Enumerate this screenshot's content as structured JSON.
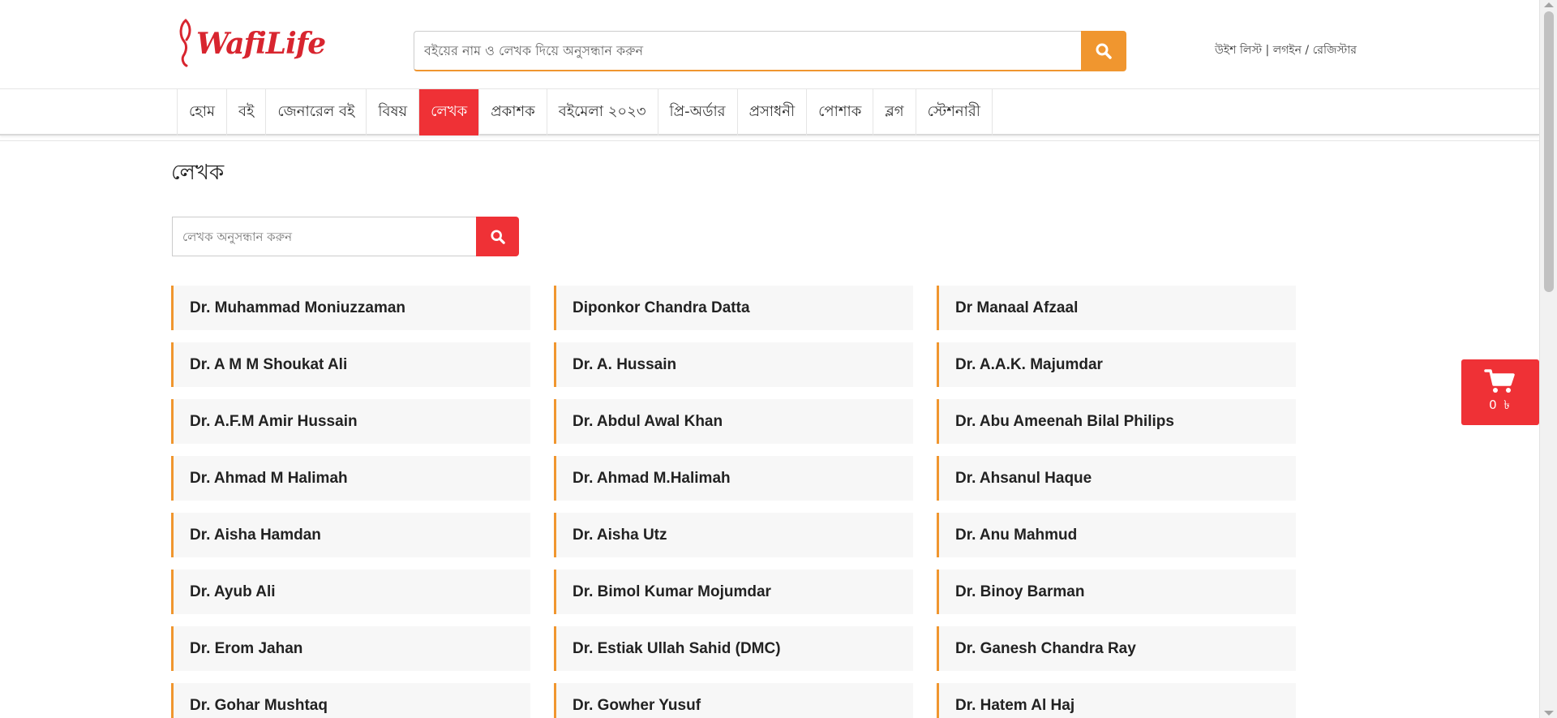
{
  "header": {
    "logo_text": "WafiLife",
    "search_placeholder": "বইয়ের নাম ও লেখক দিয়ে অনুসন্ধান করুন",
    "search_icon": "search-icon",
    "wishlist": "উইশ লিস্ট",
    "login": "লগইন",
    "register": "রেজিস্টার",
    "sep": " | ",
    "slash": " / "
  },
  "nav": {
    "items": [
      "হোম",
      "বই",
      "জেনারেল বই",
      "বিষয়",
      "লেখক",
      "প্রকাশক",
      "বইমেলা ২০২৩",
      "প্রি-অর্ডার",
      "প্রসাধনী",
      "পোশাক",
      "ব্লগ",
      "স্টেশনারী"
    ],
    "active_index": 4
  },
  "page": {
    "title": "লেখক",
    "author_search_placeholder": "লেখক অনুসন্ধান করুন"
  },
  "authors": [
    " Dr. Muhammad Moniuzzaman",
    "Diponkor Chandra Datta",
    "Dr Manaal Afzaal",
    "Dr. A M M Shoukat Ali",
    "Dr. A. Hussain",
    "Dr. A.A.K. Majumdar",
    "Dr. A.F.M Amir Hussain",
    "Dr. Abdul Awal Khan",
    "Dr. Abu Ameenah Bilal Philips",
    "Dr. Ahmad M Halimah",
    "Dr. Ahmad M.Halimah",
    "Dr. Ahsanul Haque",
    "Dr. Aisha Hamdan",
    "Dr. Aisha Utz",
    "Dr. Anu Mahmud",
    "Dr. Ayub Ali",
    "Dr. Bimol Kumar Mojumdar",
    "Dr. Binoy Barman",
    "Dr. Erom Jahan",
    "Dr. Estiak Ullah Sahid (DMC)",
    "Dr. Ganesh Chandra Ray",
    "Dr. Gohar Mushtaq",
    "Dr. Gowher Yusuf",
    "Dr. Hatem Al Haj"
  ],
  "cart": {
    "icon": "cart-icon",
    "count": "0 ৳"
  },
  "colors": {
    "brand_red": "#ef3136",
    "accent_orange": "#f0962f",
    "card_bg": "#f7f7f7"
  }
}
